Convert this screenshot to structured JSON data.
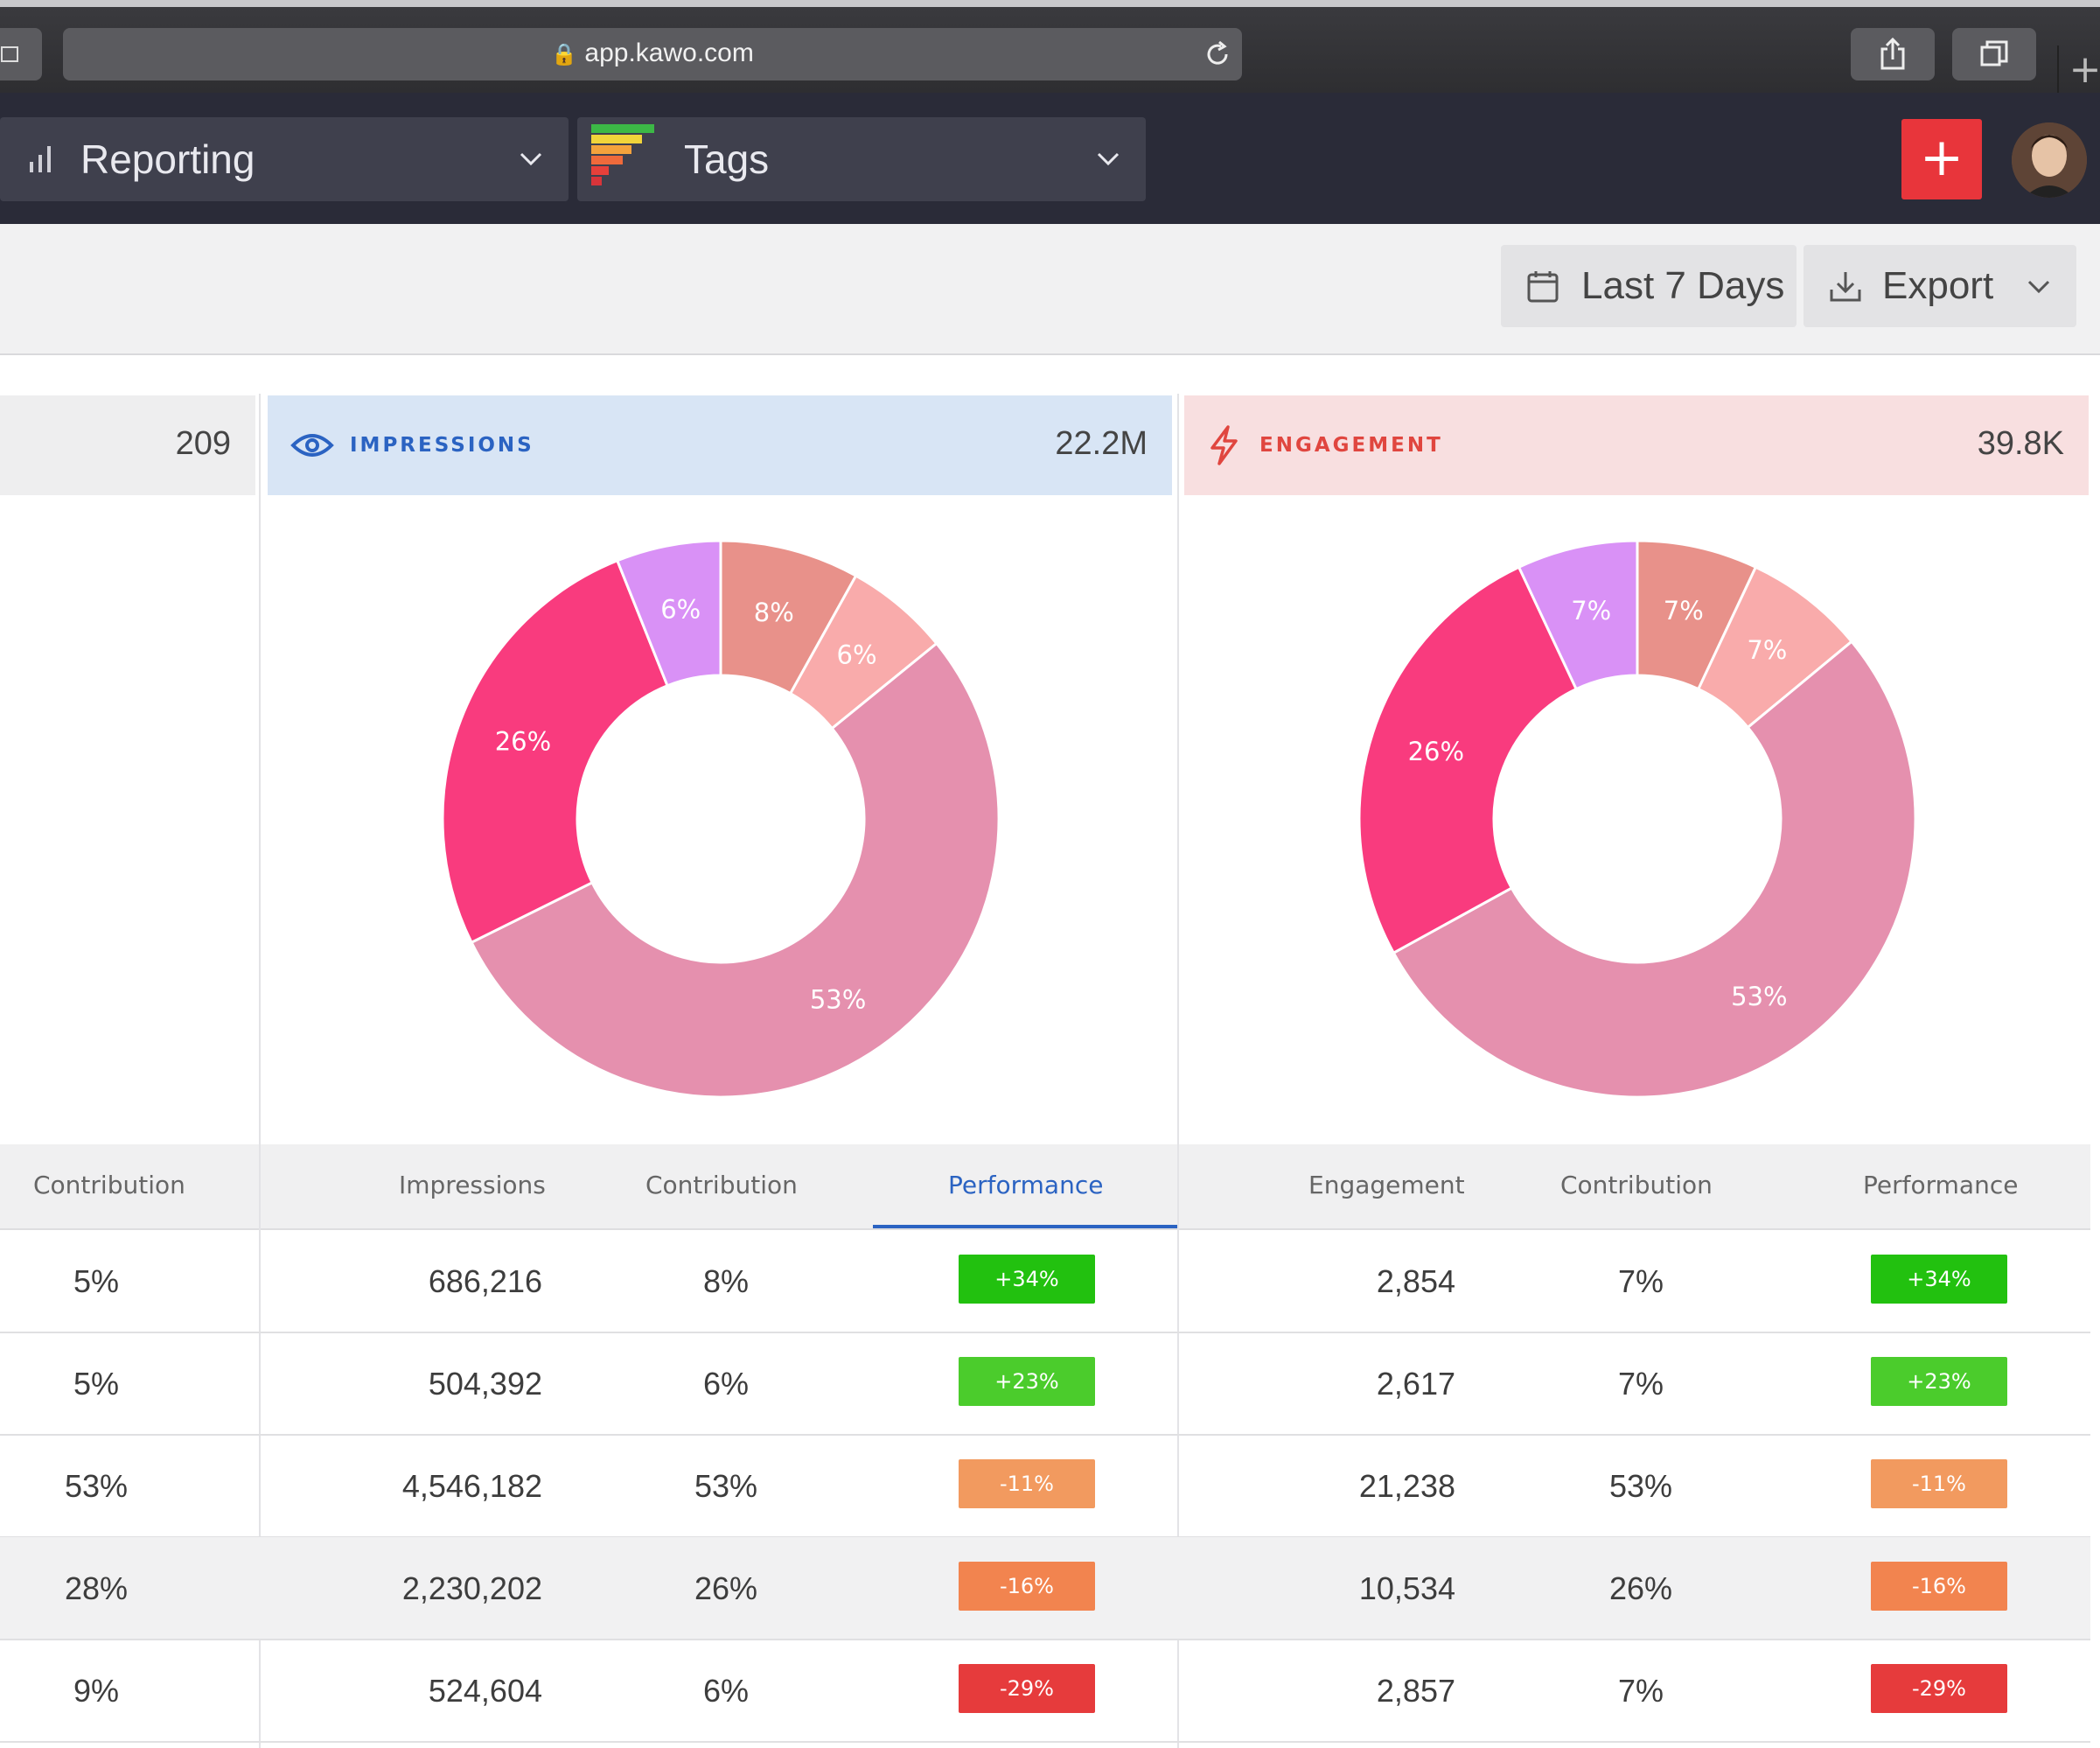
{
  "browser": {
    "url": "app.kawo.com"
  },
  "nav": {
    "reporting_label": "Reporting",
    "tags_label": "Tags",
    "add_label": "+"
  },
  "toolbar": {
    "date_range_label": "Last 7 Days",
    "export_label": "Export"
  },
  "panels": {
    "left": {
      "value": "209"
    },
    "impressions": {
      "title": "IMPRESSIONS",
      "value": "22.2M"
    },
    "engagement": {
      "title": "ENGAGEMENT",
      "value": "39.8K"
    }
  },
  "chart_data": [
    {
      "type": "pie",
      "name": "impressions-donut",
      "slices": [
        {
          "label": "8%",
          "value": 8,
          "color": "#e8918a"
        },
        {
          "label": "6%",
          "value": 6,
          "color": "#f9abab"
        },
        {
          "label": "53%",
          "value": 53,
          "color": "#e590ae"
        },
        {
          "label": "26%",
          "value": 26,
          "color": "#f93b7e"
        },
        {
          "label": "6%",
          "value": 6,
          "color": "#d991f6"
        }
      ]
    },
    {
      "type": "pie",
      "name": "engagement-donut",
      "slices": [
        {
          "label": "7%",
          "value": 7,
          "color": "#e8918a"
        },
        {
          "label": "7%",
          "value": 7,
          "color": "#f9abab"
        },
        {
          "label": "53%",
          "value": 53,
          "color": "#e590ae"
        },
        {
          "label": "26%",
          "value": 26,
          "color": "#f93b7e"
        },
        {
          "label": "7%",
          "value": 7,
          "color": "#d991f6"
        }
      ]
    }
  ],
  "table": {
    "headers": {
      "left_contribution": "Contribution",
      "impressions": "Impressions",
      "impressions_contribution": "Contribution",
      "impressions_performance": "Performance",
      "engagement": "Engagement",
      "engagement_contribution": "Contribution",
      "engagement_performance": "Performance"
    },
    "rows": [
      {
        "left_contribution": "5%",
        "impressions": "686,216",
        "imp_contribution": "8%",
        "imp_performance": "+34%",
        "engagement": "2,854",
        "eng_contribution": "7%",
        "eng_performance": "+34%",
        "perf_color": "#22c10f"
      },
      {
        "left_contribution": "5%",
        "impressions": "504,392",
        "imp_contribution": "6%",
        "imp_performance": "+23%",
        "engagement": "2,617",
        "eng_contribution": "7%",
        "eng_performance": "+23%",
        "perf_color": "#4bcc2c"
      },
      {
        "left_contribution": "53%",
        "impressions": "4,546,182",
        "imp_contribution": "53%",
        "imp_performance": "-11%",
        "engagement": "21,238",
        "eng_contribution": "53%",
        "eng_performance": "-11%",
        "perf_color": "#f29a5f"
      },
      {
        "left_contribution": "28%",
        "impressions": "2,230,202",
        "imp_contribution": "26%",
        "imp_performance": "-16%",
        "engagement": "10,534",
        "eng_contribution": "26%",
        "eng_performance": "-16%",
        "perf_color": "#f2844f"
      },
      {
        "left_contribution": "9%",
        "impressions": "524,604",
        "imp_contribution": "6%",
        "imp_performance": "-29%",
        "engagement": "2,857",
        "eng_contribution": "7%",
        "eng_performance": "-29%",
        "perf_color": "#e63b3c"
      }
    ]
  },
  "colors": {
    "accent_blue": "#2b63c2",
    "engagement_red": "#e0463f",
    "add_button_red": "#e8353b",
    "left_donut_pink": "#e590ae"
  },
  "icons": {
    "lock": "lock-icon",
    "reload": "reload-icon",
    "share": "share-icon",
    "tabs": "tabs-icon",
    "reporting": "bar-chart-icon",
    "tags": "tags-logo-icon",
    "calendar": "calendar-icon",
    "download": "download-icon",
    "eye": "eye-icon",
    "bolt": "lightning-icon",
    "chevron": "chevron-down-icon"
  }
}
